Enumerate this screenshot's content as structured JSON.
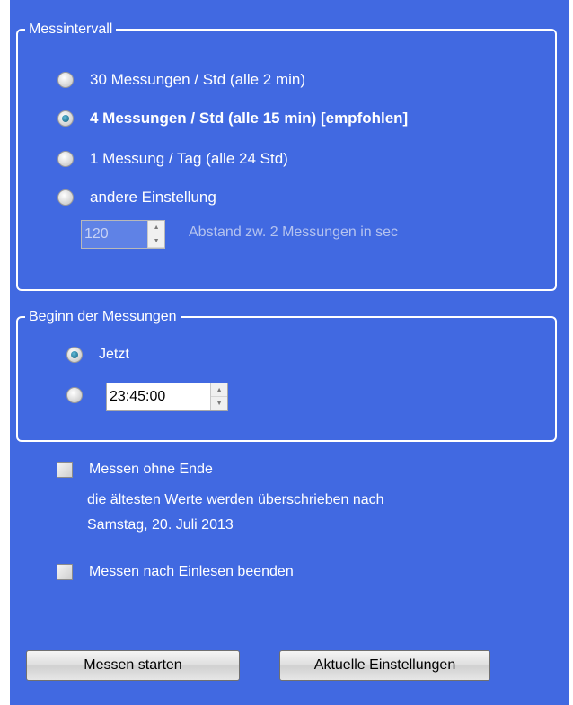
{
  "interval_group": {
    "title": "Messintervall",
    "options": [
      {
        "label": "30 Messungen / Std (alle 2 min)",
        "checked": false
      },
      {
        "label": "4 Messungen / Std (alle 15 min) [empfohlen]",
        "checked": true
      },
      {
        "label": "1 Messung / Tag (alle 24 Std)",
        "checked": false
      },
      {
        "label": "andere Einstellung",
        "checked": false
      }
    ],
    "custom_interval_value": "120",
    "custom_interval_hint": "Abstand zw. 2 Messungen in sec"
  },
  "start_group": {
    "title": "Beginn der Messungen",
    "now_label": "Jetzt",
    "now_checked": true,
    "time_checked": false,
    "time_value": "23:45:00"
  },
  "options": {
    "endless_label": "Messen ohne Ende",
    "endless_checked": false,
    "overwrite_text_line1": "die ältesten Werte werden überschrieben nach",
    "overwrite_text_line2": "Samstag, 20. Juli 2013",
    "stop_after_read_label": "Messen nach Einlesen beenden",
    "stop_after_read_checked": false
  },
  "buttons": {
    "start_label": "Messen starten",
    "current_settings_label": "Aktuelle Einstellungen"
  },
  "colors": {
    "panel_bg": "#4169e1",
    "disabled_text": "#b5c3ef",
    "radio_dot": "#11607e"
  }
}
